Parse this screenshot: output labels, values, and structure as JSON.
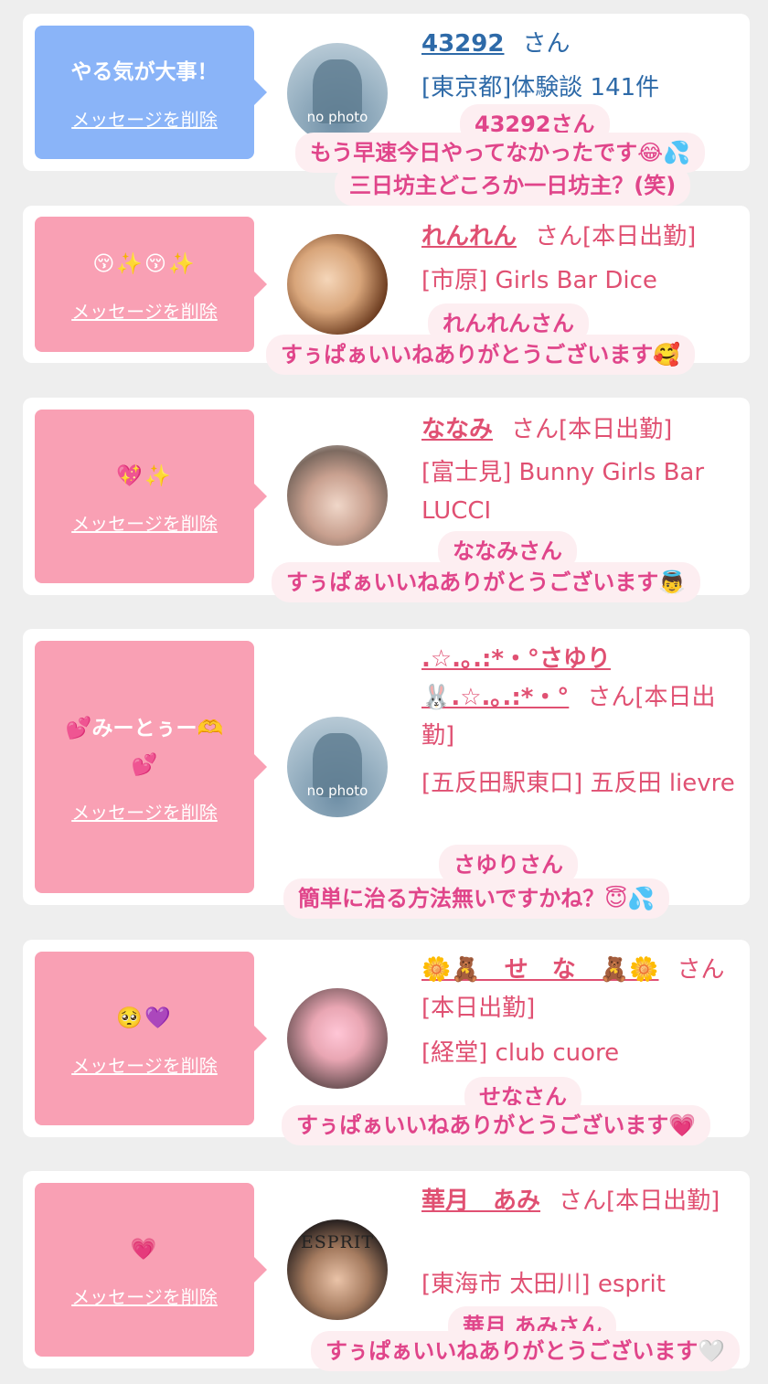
{
  "delete_label": "メッセージを削除",
  "colors": {
    "blue_bubble": "#8ab4f8",
    "pink_bubble": "#f9a0b4",
    "pink_text": "#e05072",
    "blue_text": "#2e6aa8",
    "caption_text": "#e0458a"
  },
  "items": [
    {
      "bubble_text": "やる気が大事！",
      "name": "43292",
      "suffix": "さん",
      "meta": "[東京都]体験談 141件",
      "avatar_label": "no photo",
      "caption_name": "43292さん",
      "caption_lines": [
        "もう早速今日やってなかったです😂💦",
        "三日坊主どころか一日坊主？(笑)"
      ]
    },
    {
      "bubble_text": "😚✨😚✨",
      "name": "れんれん",
      "suffix": "さん[本日出勤]",
      "meta": "[市原] Girls Bar Dice",
      "caption_name": "れんれんさん",
      "caption_lines": [
        "すぅぱぁいいねありがとうございます🥰"
      ]
    },
    {
      "bubble_text": "💖✨",
      "name": "ななみ",
      "suffix": "さん[本日出勤]",
      "meta": "[富士見] Bunny Girls Bar LUCCI",
      "caption_name": "ななみさん",
      "caption_lines": [
        "すぅぱぁいいねありがとうございます👼"
      ]
    },
    {
      "bubble_text": "💕みーとぅー🫶💕",
      "name": ".☆.｡.:*・°さゆり🐰.☆.｡.:*・°",
      "suffix": "さん[本日出勤]",
      "meta": "[五反田駅東口] 五反田 lievre",
      "avatar_label": "no photo",
      "caption_name": "さゆりさん",
      "caption_lines": [
        "簡単に治る方法無いですかね？😇💦"
      ]
    },
    {
      "bubble_text": "🥺💜",
      "name": "🌼🧸　せ　な　🧸🌼",
      "suffix": "さん[本日出勤]",
      "meta": "[経堂] club cuore",
      "caption_name": "せなさん",
      "caption_lines": [
        "すぅぱぁいいねありがとうございます💗"
      ]
    },
    {
      "bubble_text": "💗",
      "name": "華月　あみ",
      "suffix": "さん[本日出勤]",
      "meta": "[東海市 太田川] esprit",
      "avatar_label": "ESPRIT",
      "caption_name": "華月 あみさん",
      "caption_lines": [
        "すぅぱぁいいねありがとうございます🤍"
      ]
    }
  ]
}
